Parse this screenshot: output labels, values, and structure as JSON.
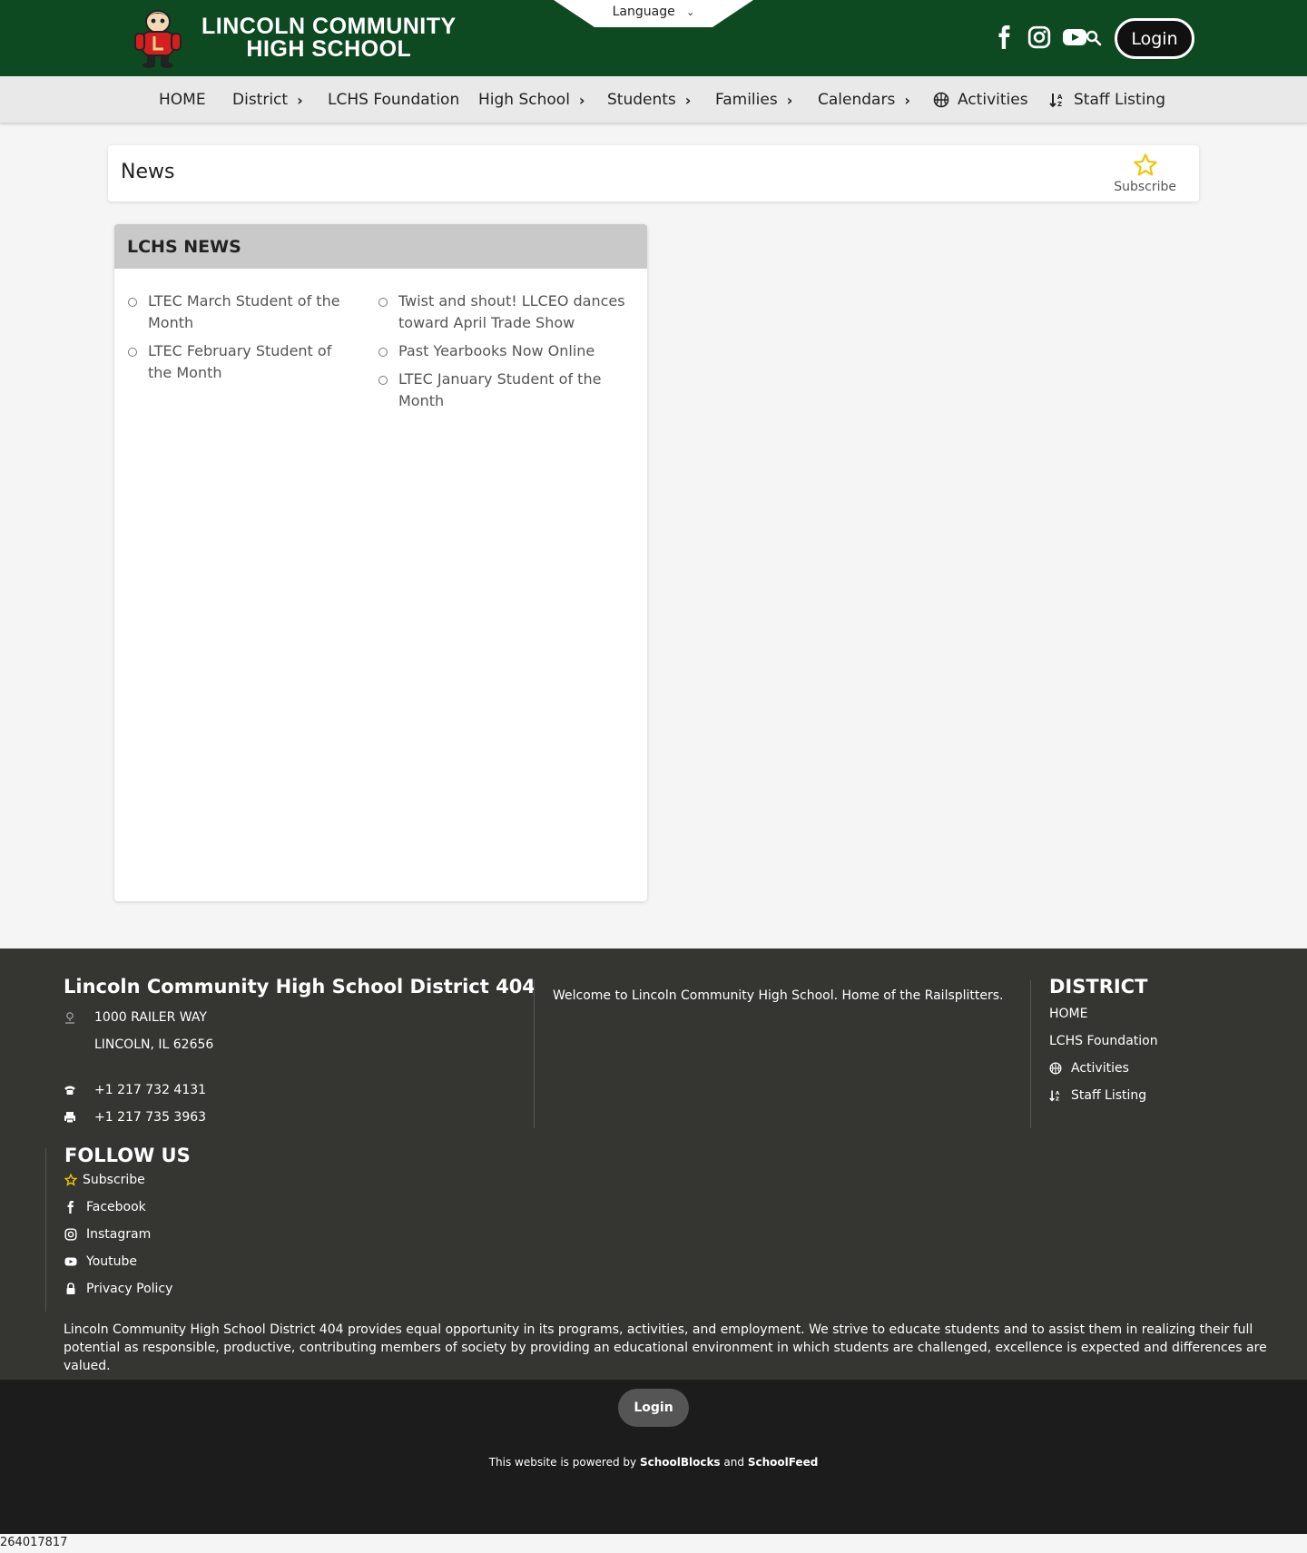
{
  "header": {
    "school_name_line1": "LINCOLN COMMUNITY",
    "school_name_line2": "HIGH SCHOOL",
    "language_label": "Language",
    "login_label": "Login",
    "social_icons": [
      "facebook-icon",
      "instagram-icon",
      "youtube-icon"
    ],
    "colors": {
      "brand_green": "#0d4a22",
      "mascot_red": "#d22020"
    }
  },
  "nav": {
    "items": [
      {
        "label": "HOME",
        "has_arrow": false
      },
      {
        "label": "District",
        "has_arrow": true
      },
      {
        "label": "LCHS Foundation",
        "has_arrow": false
      },
      {
        "label": "High School",
        "has_arrow": true
      },
      {
        "label": "Students",
        "has_arrow": true
      },
      {
        "label": "Families",
        "has_arrow": true
      },
      {
        "label": "Calendars",
        "has_arrow": true
      },
      {
        "label": "Activities",
        "icon": "basketball-icon"
      },
      {
        "label": "Staff Listing",
        "icon": "sort-icon"
      }
    ]
  },
  "page": {
    "title": "News",
    "subscribe_label": "Subscribe",
    "star_color": "#f0c400"
  },
  "news_block": {
    "heading": "LCHS NEWS",
    "left_items": [
      "LTEC March Student of the Month",
      "LTEC February Student of the Month"
    ],
    "right_items": [
      "Twist and shout! LLCEO dances toward April Trade Show",
      "Past Yearbooks Now Online",
      "LTEC January Student of the Month"
    ]
  },
  "footer": {
    "district_name": "Lincoln Community High School District 404",
    "address_line1": "1000 RAILER WAY",
    "address_line2": "LINCOLN, IL 62656",
    "phone": "+1 217 732 4131",
    "fax": "+1 217 735 3963",
    "welcome": "Welcome to Lincoln Community High School.  Home of the Railsplitters.",
    "district_heading": "DISTRICT",
    "district_links": [
      "HOME",
      "LCHS Foundation",
      "Activities",
      "Staff Listing"
    ],
    "follow_heading": "FOLLOW US",
    "follow_links": [
      "Subscribe",
      "Facebook",
      "Instagram",
      "Youtube",
      "Privacy Policy"
    ],
    "disclaimer": "Lincoln Community High School District 404 provides equal opportunity in its programs, activities, and employment. We strive to educate students and to assist them in realizing their full potential as responsible, productive, contributing members of society by providing an educational environment in which students are challenged, excellence is expected and differences are valued."
  },
  "bottom": {
    "login_label": "Login",
    "powered_prefix": "This website is powered by",
    "powered_brand1": "SchoolBlocks",
    "powered_and": "and",
    "powered_brand2": "SchoolFeed",
    "page_id": "264017817"
  }
}
